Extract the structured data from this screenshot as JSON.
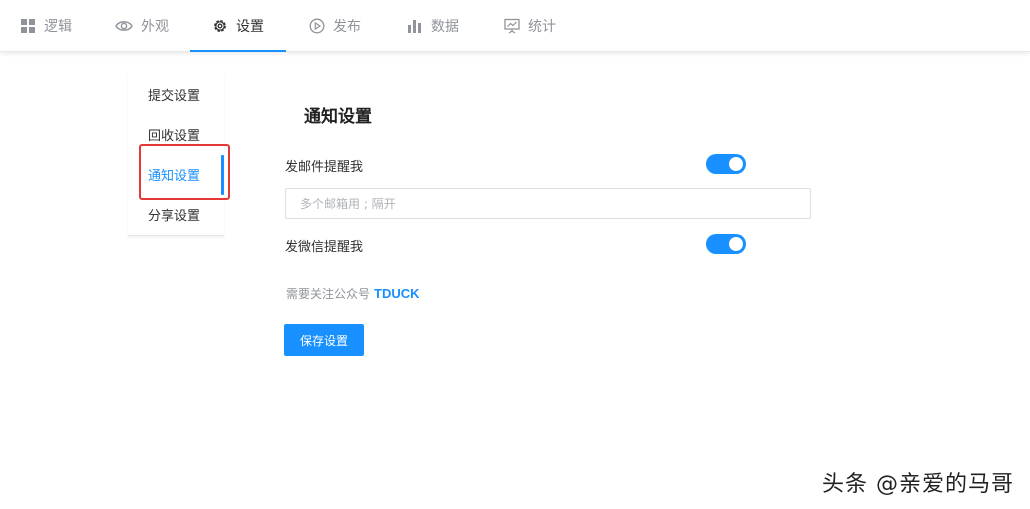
{
  "tabs": [
    {
      "label": "逻辑",
      "icon": "grid-icon"
    },
    {
      "label": "外观",
      "icon": "eye-icon"
    },
    {
      "label": "设置",
      "icon": "gear-icon"
    },
    {
      "label": "发布",
      "icon": "play-icon"
    },
    {
      "label": "数据",
      "icon": "bar-chart-icon"
    },
    {
      "label": "统计",
      "icon": "presentation-chart-icon"
    }
  ],
  "active_tab": "设置",
  "side_menu": {
    "items": [
      {
        "label": "提交设置"
      },
      {
        "label": "回收设置"
      },
      {
        "label": "通知设置"
      },
      {
        "label": "分享设置"
      }
    ],
    "active": "通知设置"
  },
  "panel": {
    "title": "通知设置",
    "email_notify_label": "发邮件提醒我",
    "email_notify_on": true,
    "email_placeholder": "多个邮箱用 ; 隔开",
    "wechat_notify_label": "发微信提醒我",
    "wechat_notify_on": true,
    "note_text": "需要关注公众号",
    "note_brand": "TDUCK",
    "save_label": "保存设置"
  },
  "watermark": "头条 @亲爱的马哥",
  "colors": {
    "accent": "#1890ff",
    "highlight": "#e53935"
  }
}
